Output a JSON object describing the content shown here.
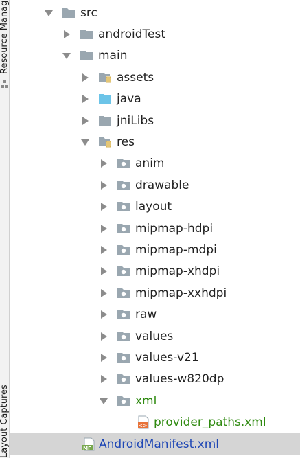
{
  "side_tabs": {
    "resource_manager": "Resource Manager",
    "layout_captures": "Layout Captures"
  },
  "tree": [
    {
      "label": "src",
      "depth": 0,
      "expanded": true,
      "icon": "folder-icon"
    },
    {
      "label": "androidTest",
      "depth": 1,
      "expanded": false,
      "icon": "folder-icon"
    },
    {
      "label": "main",
      "depth": 1,
      "expanded": true,
      "icon": "folder-icon"
    },
    {
      "label": "assets",
      "depth": 2,
      "expanded": false,
      "icon": "resource-folder-icon"
    },
    {
      "label": "java",
      "depth": 2,
      "expanded": false,
      "icon": "source-folder-icon"
    },
    {
      "label": "jniLibs",
      "depth": 2,
      "expanded": false,
      "icon": "folder-icon"
    },
    {
      "label": "res",
      "depth": 2,
      "expanded": true,
      "icon": "resource-folder-icon"
    },
    {
      "label": "anim",
      "depth": 3,
      "expanded": false,
      "icon": "package-folder-icon"
    },
    {
      "label": "drawable",
      "depth": 3,
      "expanded": false,
      "icon": "package-folder-icon"
    },
    {
      "label": "layout",
      "depth": 3,
      "expanded": false,
      "icon": "package-folder-icon"
    },
    {
      "label": "mipmap-hdpi",
      "depth": 3,
      "expanded": false,
      "icon": "package-folder-icon"
    },
    {
      "label": "mipmap-mdpi",
      "depth": 3,
      "expanded": false,
      "icon": "package-folder-icon"
    },
    {
      "label": "mipmap-xhdpi",
      "depth": 3,
      "expanded": false,
      "icon": "package-folder-icon"
    },
    {
      "label": "mipmap-xxhdpi",
      "depth": 3,
      "expanded": false,
      "icon": "package-folder-icon"
    },
    {
      "label": "raw",
      "depth": 3,
      "expanded": false,
      "icon": "package-folder-icon"
    },
    {
      "label": "values",
      "depth": 3,
      "expanded": false,
      "icon": "package-folder-icon"
    },
    {
      "label": "values-v21",
      "depth": 3,
      "expanded": false,
      "icon": "package-folder-icon"
    },
    {
      "label": "values-w820dp",
      "depth": 3,
      "expanded": false,
      "icon": "package-folder-icon"
    },
    {
      "label": "xml",
      "depth": 3,
      "expanded": true,
      "icon": "package-folder-icon",
      "color": "#2f8a10"
    },
    {
      "label": "provider_paths.xml",
      "depth": 4,
      "leaf": true,
      "icon": "xml-file-icon",
      "color": "#2f8a10"
    },
    {
      "label": "AndroidManifest.xml",
      "depth": 2,
      "leaf": true,
      "icon": "manifest-file-icon",
      "color": "#1f47b5",
      "selected": true
    }
  ]
}
